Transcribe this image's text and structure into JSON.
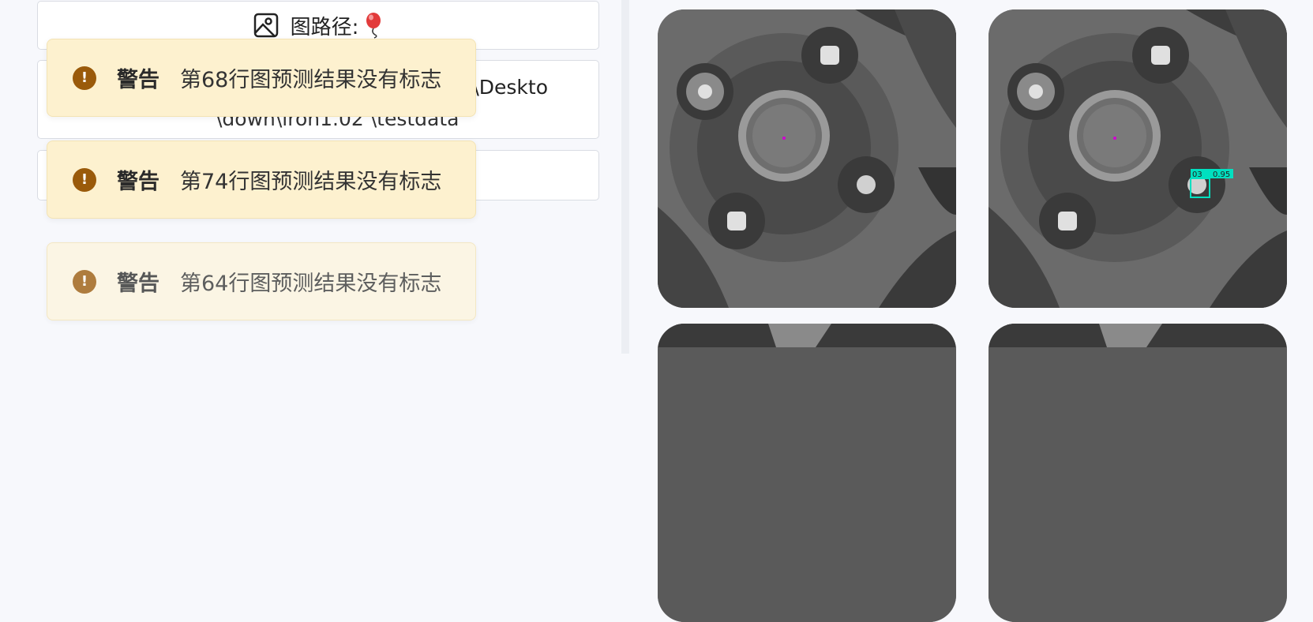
{
  "image_path_card": {
    "label": "图路径:"
  },
  "path_card": {
    "line1": "tor\\Deskto",
    "line2": "\\down\\iron1.02 \\testdata"
  },
  "toasts": [
    {
      "title": "警告",
      "message": "第68行图预测结果没有标志"
    },
    {
      "title": "警告",
      "message": "第74行图预测结果没有标志"
    },
    {
      "title": "警告",
      "message": "第64行图预测结果没有标志"
    }
  ],
  "detections": {
    "label": "03",
    "score": "0.95",
    "box_color": "#00e0c0"
  },
  "colors": {
    "warning_bg": "#fdf1cf",
    "warning_icon": "#9a5a0a",
    "panel_bg": "#f7f8fc"
  }
}
